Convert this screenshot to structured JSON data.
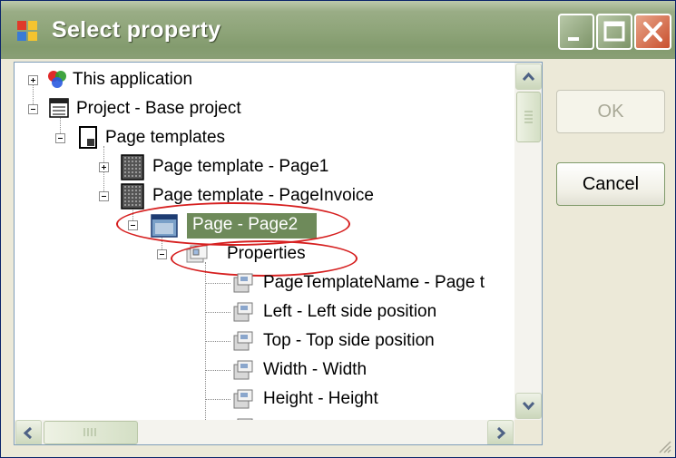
{
  "window": {
    "title": "Select property",
    "colors": {
      "titlebar": "#8fa57a",
      "close_button": "#c9502e",
      "selection": "#6e8a5a",
      "annotation": "#d62020"
    }
  },
  "tree": {
    "nodes": [
      {
        "label": "This application",
        "icon": "application-icon",
        "expander": "plus"
      },
      {
        "label": "Project - Base project",
        "icon": "project-icon",
        "expander": "minus"
      },
      {
        "label": "Page templates",
        "icon": "page-templates-icon",
        "expander": "minus"
      },
      {
        "label": "Page template - Page1",
        "icon": "page-template-icon",
        "expander": "plus"
      },
      {
        "label": "Page template - PageInvoice",
        "icon": "page-template-icon",
        "expander": "minus"
      },
      {
        "label": "Page - Page2",
        "icon": "page-icon",
        "expander": "minus",
        "selected": true
      },
      {
        "label": "Properties",
        "icon": "properties-icon",
        "expander": "minus"
      },
      {
        "label": "PageTemplateName - Page t",
        "icon": "property-icon"
      },
      {
        "label": "Left - Left side position",
        "icon": "property-icon"
      },
      {
        "label": "Top - Top side position",
        "icon": "property-icon"
      },
      {
        "label": "Width - Width",
        "icon": "property-icon"
      },
      {
        "label": "Height - Height",
        "icon": "property-icon"
      }
    ]
  },
  "buttons": {
    "ok_label": "OK",
    "cancel_label": "Cancel"
  }
}
